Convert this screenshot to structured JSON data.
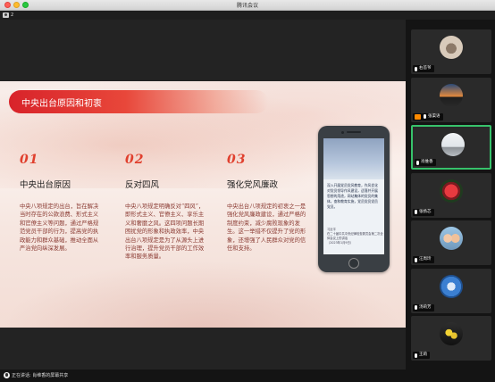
{
  "window": {
    "title": "腾讯会议"
  },
  "share": {
    "count": "2"
  },
  "slide": {
    "title": "中央出台原因和初衷",
    "columns": [
      {
        "num": "01",
        "heading": "中央出台原因",
        "body": "中央八项规定的出台，旨在解决当时存在的公款浪费、形式主义和官僚主义等问题，通过严格规范党员干部的行为，提高党的执政能力和群众基础，推动全面从严治党向纵深发展。"
      },
      {
        "num": "02",
        "heading": "反对四风",
        "body": "中央八项规定明确反对“四风”，即形式主义、官僚主义、享乐主义和奢靡之风。这四项问题长期困扰党的形象和执政效率，中央出台八项规定是为了从源头上进行治理，提升党员干部的工作效率和服务质量。"
      },
      {
        "num": "03",
        "heading": "强化党风廉政",
        "body": "中央出台八项规定的初衷之一是强化党风廉政建设，通过严格的制度约束，减少腐败现象的发生。这一举措不仅提升了党的形象，还增强了人民群众对党的信任和支持。"
      }
    ],
    "phone": {
      "text": "深入开展党员党风教育，作风优化对党员领导作风建设，适落并开展思想的用途，网站集体的党员的集体，查和教育实施，党员党员党员党员。",
      "footer": "习近平\n在二十届中共中央纪律检查委员会第二次全体会议上的讲话\n（2023年1月9日）"
    }
  },
  "participants": [
    {
      "name": "右首爷",
      "avatar": "animal",
      "color": "#c9b7a5",
      "active": false,
      "badge": false
    },
    {
      "name": "张渠语",
      "avatar": "sunset",
      "color": "#e58a3c",
      "active": false,
      "badge": true
    },
    {
      "name": "肖维香",
      "avatar": "room",
      "color": "#d7dde3",
      "active": true,
      "badge": false
    },
    {
      "name": "张扬芯",
      "avatar": "flower",
      "color": "#c32a34",
      "active": false,
      "badge": false
    },
    {
      "name": "汪周玲",
      "avatar": "kids",
      "color": "#7aa5c6",
      "active": false,
      "badge": false
    },
    {
      "name": "汤莉芳",
      "avatar": "blue",
      "color": "#3b7fd1",
      "active": false,
      "badge": false
    },
    {
      "name": "王莉",
      "avatar": "yellow-flower",
      "color": "#e6c22e",
      "active": false,
      "badge": false
    }
  ],
  "status": {
    "speaking": "正在讲话: 肖维香的屏幕共享"
  }
}
